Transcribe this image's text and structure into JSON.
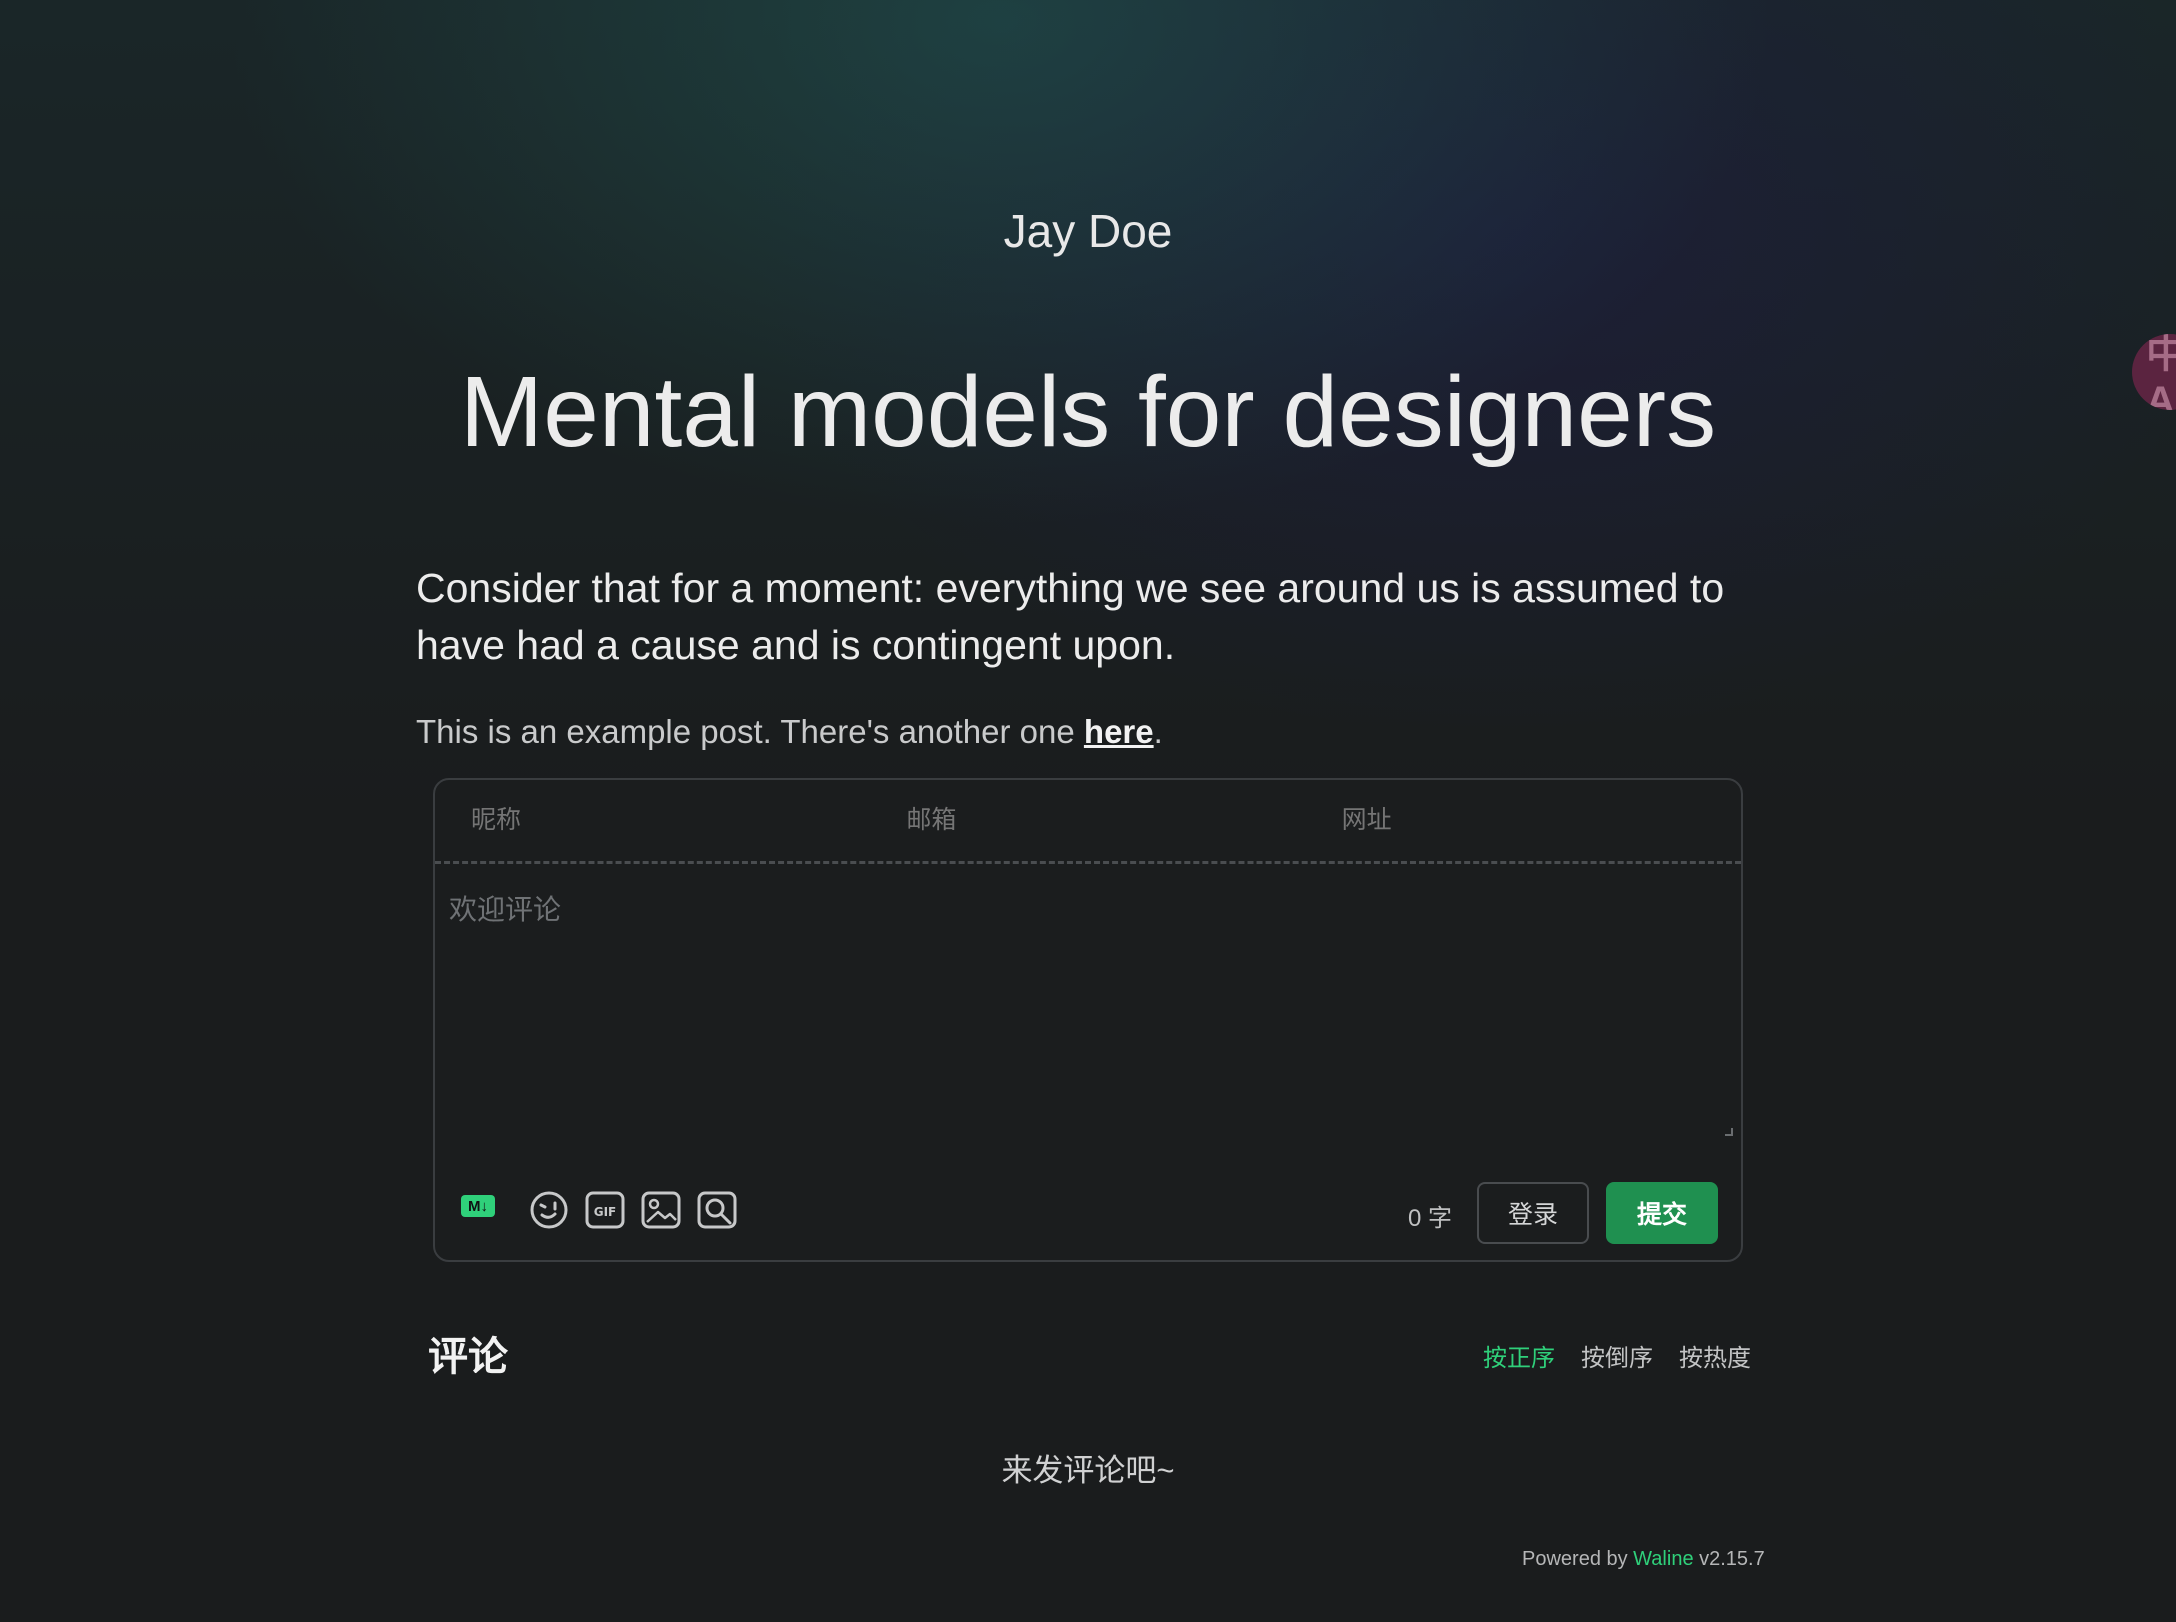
{
  "header": {
    "author": "Jay Doe",
    "title": "Mental models for designers"
  },
  "article": {
    "lead": "Consider that for a moment: everything we see around us is assumed to have had a cause and is contingent upon.",
    "note_prefix": "This is an example post. There's another one ",
    "note_link": "here",
    "note_suffix": "."
  },
  "language_toggle": {
    "label": "中A"
  },
  "comment_form": {
    "nickname_placeholder": "昵称",
    "email_placeholder": "邮箱",
    "website_placeholder": "网址",
    "editor_placeholder": "欢迎评论",
    "toolbar": {
      "markdown_icon_text": "M↓",
      "icons": [
        "emoji-icon",
        "gif-icon",
        "image-icon",
        "preview-icon"
      ]
    },
    "word_count": "0",
    "word_unit": "字",
    "login_label": "登录",
    "submit_label": "提交"
  },
  "comments": {
    "title": "评论",
    "sort_options": [
      "按正序",
      "按倒序",
      "按热度"
    ],
    "active_sort": "按正序",
    "empty_text": "来发评论吧~"
  },
  "footer": {
    "powered_prefix": "Powered by ",
    "brand": "Waline",
    "version": " v2.15.7"
  },
  "colors": {
    "accent": "#2fd07a",
    "submit_bg": "#1f9050",
    "page_bg": "#1a1c1d"
  }
}
